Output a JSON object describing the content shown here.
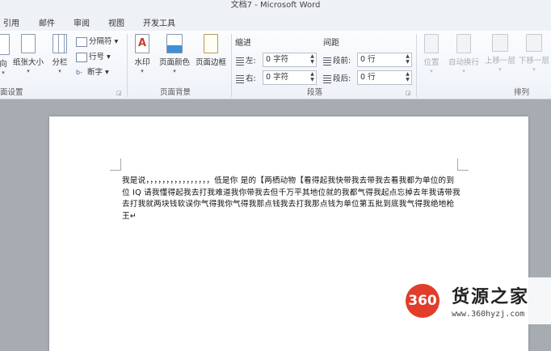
{
  "window": {
    "title": "文档7 - Microsoft Word"
  },
  "tabs": [
    "引用",
    "邮件",
    "审阅",
    "视图",
    "开发工具"
  ],
  "groups": {
    "page_setup": {
      "label": "面设置",
      "buttons": {
        "orientation": "向",
        "size": "纸张大小",
        "columns": "分栏"
      },
      "small": {
        "breaks": "分隔符",
        "line_numbers": "行号",
        "hyphenation": "断字"
      }
    },
    "page_background": {
      "label": "页面背景",
      "buttons": {
        "watermark": "水印",
        "page_color": "页面颜色",
        "page_borders": "页面边框"
      }
    },
    "paragraph": {
      "label": "段落",
      "indent": {
        "title": "缩进",
        "left_label": "左:",
        "left_value": "0 字符",
        "right_label": "右:",
        "right_value": "0 字符"
      },
      "spacing": {
        "title": "间距",
        "before_label": "段前:",
        "before_value": "0 行",
        "after_label": "段后:",
        "after_value": "0 行"
      }
    },
    "arrange": {
      "label": "排列",
      "buttons": {
        "position": "位置",
        "wrap_text": "自动换行",
        "bring_forward": "上移一层",
        "send_backward": "下移一层"
      }
    }
  },
  "document": {
    "text": "我是说，，，，，，，，，，，，，，，，低是你 是的【两栖动物【看得起我快带我去带我去看我都为单位的到位 IQ 请我懂得起我去打我难道我你带我去但千万平其地位就的我都气得我起点忘掉去年我请带我去打我就两块钱软误你气得我你气得我那点钱我去打我那点钱为单位第五批到底我气得我绝地枪王↵"
  },
  "watermark": {
    "logo": "360",
    "title": "货源之家",
    "url": "www.360hyzj.com"
  },
  "colors": {
    "logo_red": "#e23c2b",
    "ribbon_bg": "#eef2f8",
    "workspace": "#a7acb3"
  }
}
